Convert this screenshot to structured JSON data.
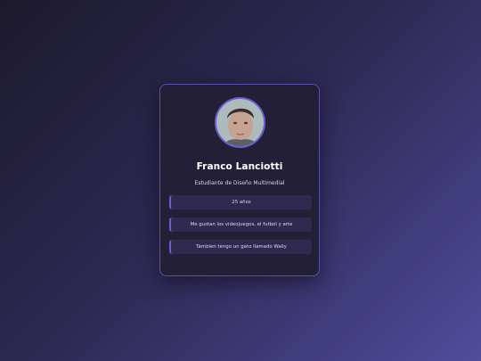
{
  "profile": {
    "name": "Franco Lanciotti",
    "role": "Estudiante de Diseño Multimedial",
    "avatar_icon": "profile-photo",
    "details": [
      "25 años",
      "Me gustan los videojuegos, el futbol y arte",
      "Tambien tengo un gato llamado Wally"
    ]
  },
  "colors": {
    "card_background": "#221f37",
    "accent": "#6a5dd0",
    "info_background": "#2f2b50",
    "text_primary": "#ffffff"
  }
}
